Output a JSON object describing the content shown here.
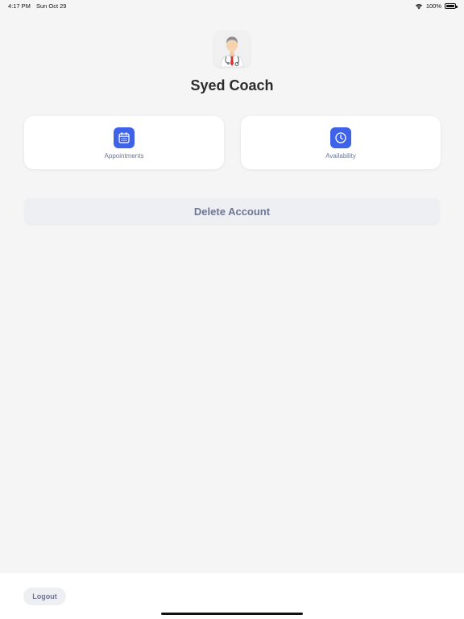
{
  "status_bar": {
    "time": "4:17 PM",
    "date": "Sun Oct 29",
    "battery": "100%"
  },
  "profile": {
    "avatar_icon": "doctor-avatar-icon",
    "name": "Syed Coach"
  },
  "cards": [
    {
      "label": "Appointments",
      "icon": "calendar-icon"
    },
    {
      "label": "Availability",
      "icon": "clock-icon"
    }
  ],
  "actions": {
    "delete_account": "Delete Account",
    "logout": "Logout"
  },
  "colors": {
    "accent": "#3f63e8",
    "background": "#f5f5f5",
    "muted_text": "#6e7591",
    "button_bg": "#eeeff2"
  }
}
